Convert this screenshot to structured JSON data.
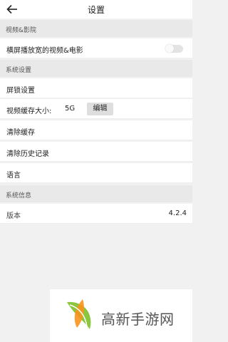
{
  "header": {
    "title": "设置"
  },
  "sections": {
    "video": {
      "title": "视频&影院",
      "landscape_label": "横屏播放宽的视频&电影",
      "landscape_enabled": false
    },
    "system": {
      "title": "系统设置",
      "screen_lock": "屏锁设置",
      "cache_size_label": "视频缓存大小:",
      "cache_size_value": "5G",
      "edit_label": "编辑",
      "clear_cache": "清除缓存",
      "clear_history": "清除历史记录",
      "language": "语言"
    },
    "info": {
      "title": "系统信息",
      "version_label": "版本",
      "version_value": "4.2.4"
    }
  },
  "watermark": {
    "text": "高新手游网"
  },
  "colors": {
    "logo_green": "#8cc63f",
    "logo_orange": "#f7941d"
  },
  "icons": [
    "back-arrow-icon",
    "toggle-switch",
    "logo-icon"
  ]
}
